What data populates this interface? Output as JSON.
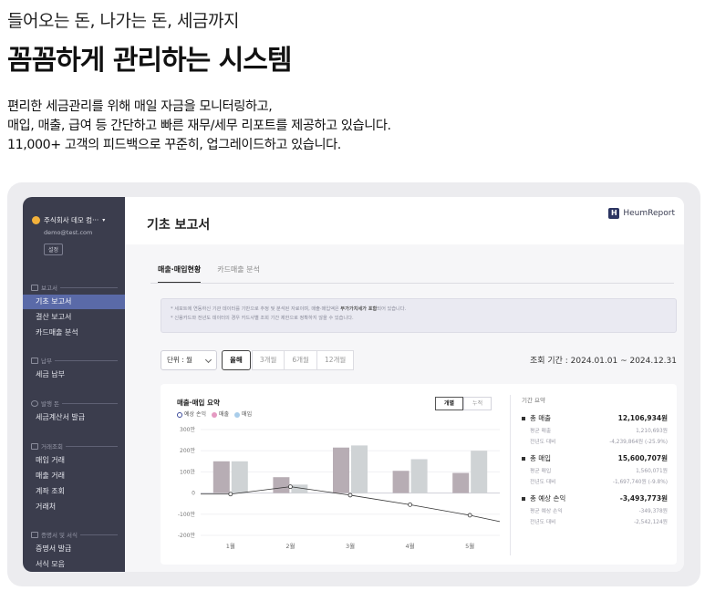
{
  "hero": {
    "subtitle": "들어오는 돈, 나가는 돈, 세금까지",
    "title": "꼼꼼하게 관리하는 시스템",
    "desc": [
      "편리한 세금관리를 위해 매일 자금을 모니터링하고,",
      "매입, 매출, 급여 등 간단하고 빠른 재무/세무 리포트를 제공하고 있습니다.",
      "11,000+ 고객의 피드백으로 꾸준히, 업그레이드하고 있습니다."
    ]
  },
  "sidebar": {
    "company": "주식회사 데모 컴···",
    "email": "demo@test.com",
    "settings": "설정",
    "sections": [
      {
        "label": "보고서",
        "items": [
          "기초 보고서",
          "결산 보고서",
          "카드매출 분석"
        ]
      },
      {
        "label": "납부",
        "items": [
          "세금 납부"
        ]
      },
      {
        "label": "발행 돈",
        "items": [
          "세금계산서 발급"
        ]
      },
      {
        "label": "거래조회",
        "items": [
          "매입 거래",
          "매출 거래",
          "계좌 조회",
          "거래처"
        ]
      },
      {
        "label": "증명서 및 서식",
        "items": [
          "증명서 발급",
          "서식 모음"
        ]
      }
    ],
    "active_item": "기초 보고서"
  },
  "main": {
    "title": "기초 보고서",
    "brand": "HeumReport",
    "tabs": [
      "매출·매입현황",
      "카드매출 분석"
    ],
    "notice": {
      "line1_pre": "* 세포트에 연동하신 기관 데이터를 기반으로 추정 및 분석된 자료이며, 매출·매입액은 ",
      "line1_bold": "부가가치세가 포함",
      "line1_post": "되어 있습니다.",
      "line2": "* 신용카드와 전년도 데이터의 경우 카드사별 조회 기간 제한으로 정확하지 않을 수 있습니다."
    },
    "unit_select": "단위 : 월",
    "periods": [
      "올해",
      "3개월",
      "6개월",
      "12개월"
    ],
    "period_range": "조회 기간 : 2024.01.01 ~ 2024.12.31",
    "chart": {
      "title": "매출·매입 요약",
      "toggle": [
        "개별",
        "누적"
      ]
    },
    "summary": {
      "heading": "기간 요약",
      "blocks": [
        {
          "label": "총 매출",
          "value": "12,106,934원",
          "sub": [
            [
              "평균 매출",
              "1,210,693원"
            ],
            [
              "전년도 대비",
              "-4,239,864원 (-25.9%)"
            ]
          ]
        },
        {
          "label": "총 매입",
          "value": "15,600,707원",
          "sub": [
            [
              "평균 매입",
              "1,560,071원"
            ],
            [
              "전년도 대비",
              "-1,697,740원 (-9.8%)"
            ]
          ]
        },
        {
          "label": "총 예상 손익",
          "value": "-3,493,773원",
          "sub": [
            [
              "평균 예상 손익",
              "-349,378원"
            ],
            [
              "전년도 대비",
              "-2,542,124원"
            ]
          ]
        }
      ]
    }
  },
  "colors": {
    "sales": "#b7adb4",
    "purchase": "#cfd3d5",
    "profit": "#333333",
    "sidebar_bg": "#3b3d4d",
    "active": "#5a6aa8"
  },
  "chart_data": {
    "type": "bar",
    "categories": [
      "1월",
      "2월",
      "3월",
      "4월",
      "5월"
    ],
    "ylim": [
      -200,
      300
    ],
    "yticks": [
      "300만",
      "200만",
      "100만",
      "0",
      "-100만",
      "-200만"
    ],
    "yticks_values": [
      300,
      200,
      100,
      0,
      -100,
      -200
    ],
    "series": [
      {
        "name": "매출",
        "values": [
          150,
          75,
          215,
          105,
          95
        ]
      },
      {
        "name": "매입",
        "values": [
          150,
          40,
          225,
          160,
          200
        ]
      },
      {
        "name": "예상 손익",
        "type": "line",
        "values": [
          -5,
          30,
          -10,
          -55,
          -105
        ]
      }
    ],
    "legend": [
      "예상 손익",
      "매출",
      "매입"
    ],
    "legend_position": "top-left"
  }
}
